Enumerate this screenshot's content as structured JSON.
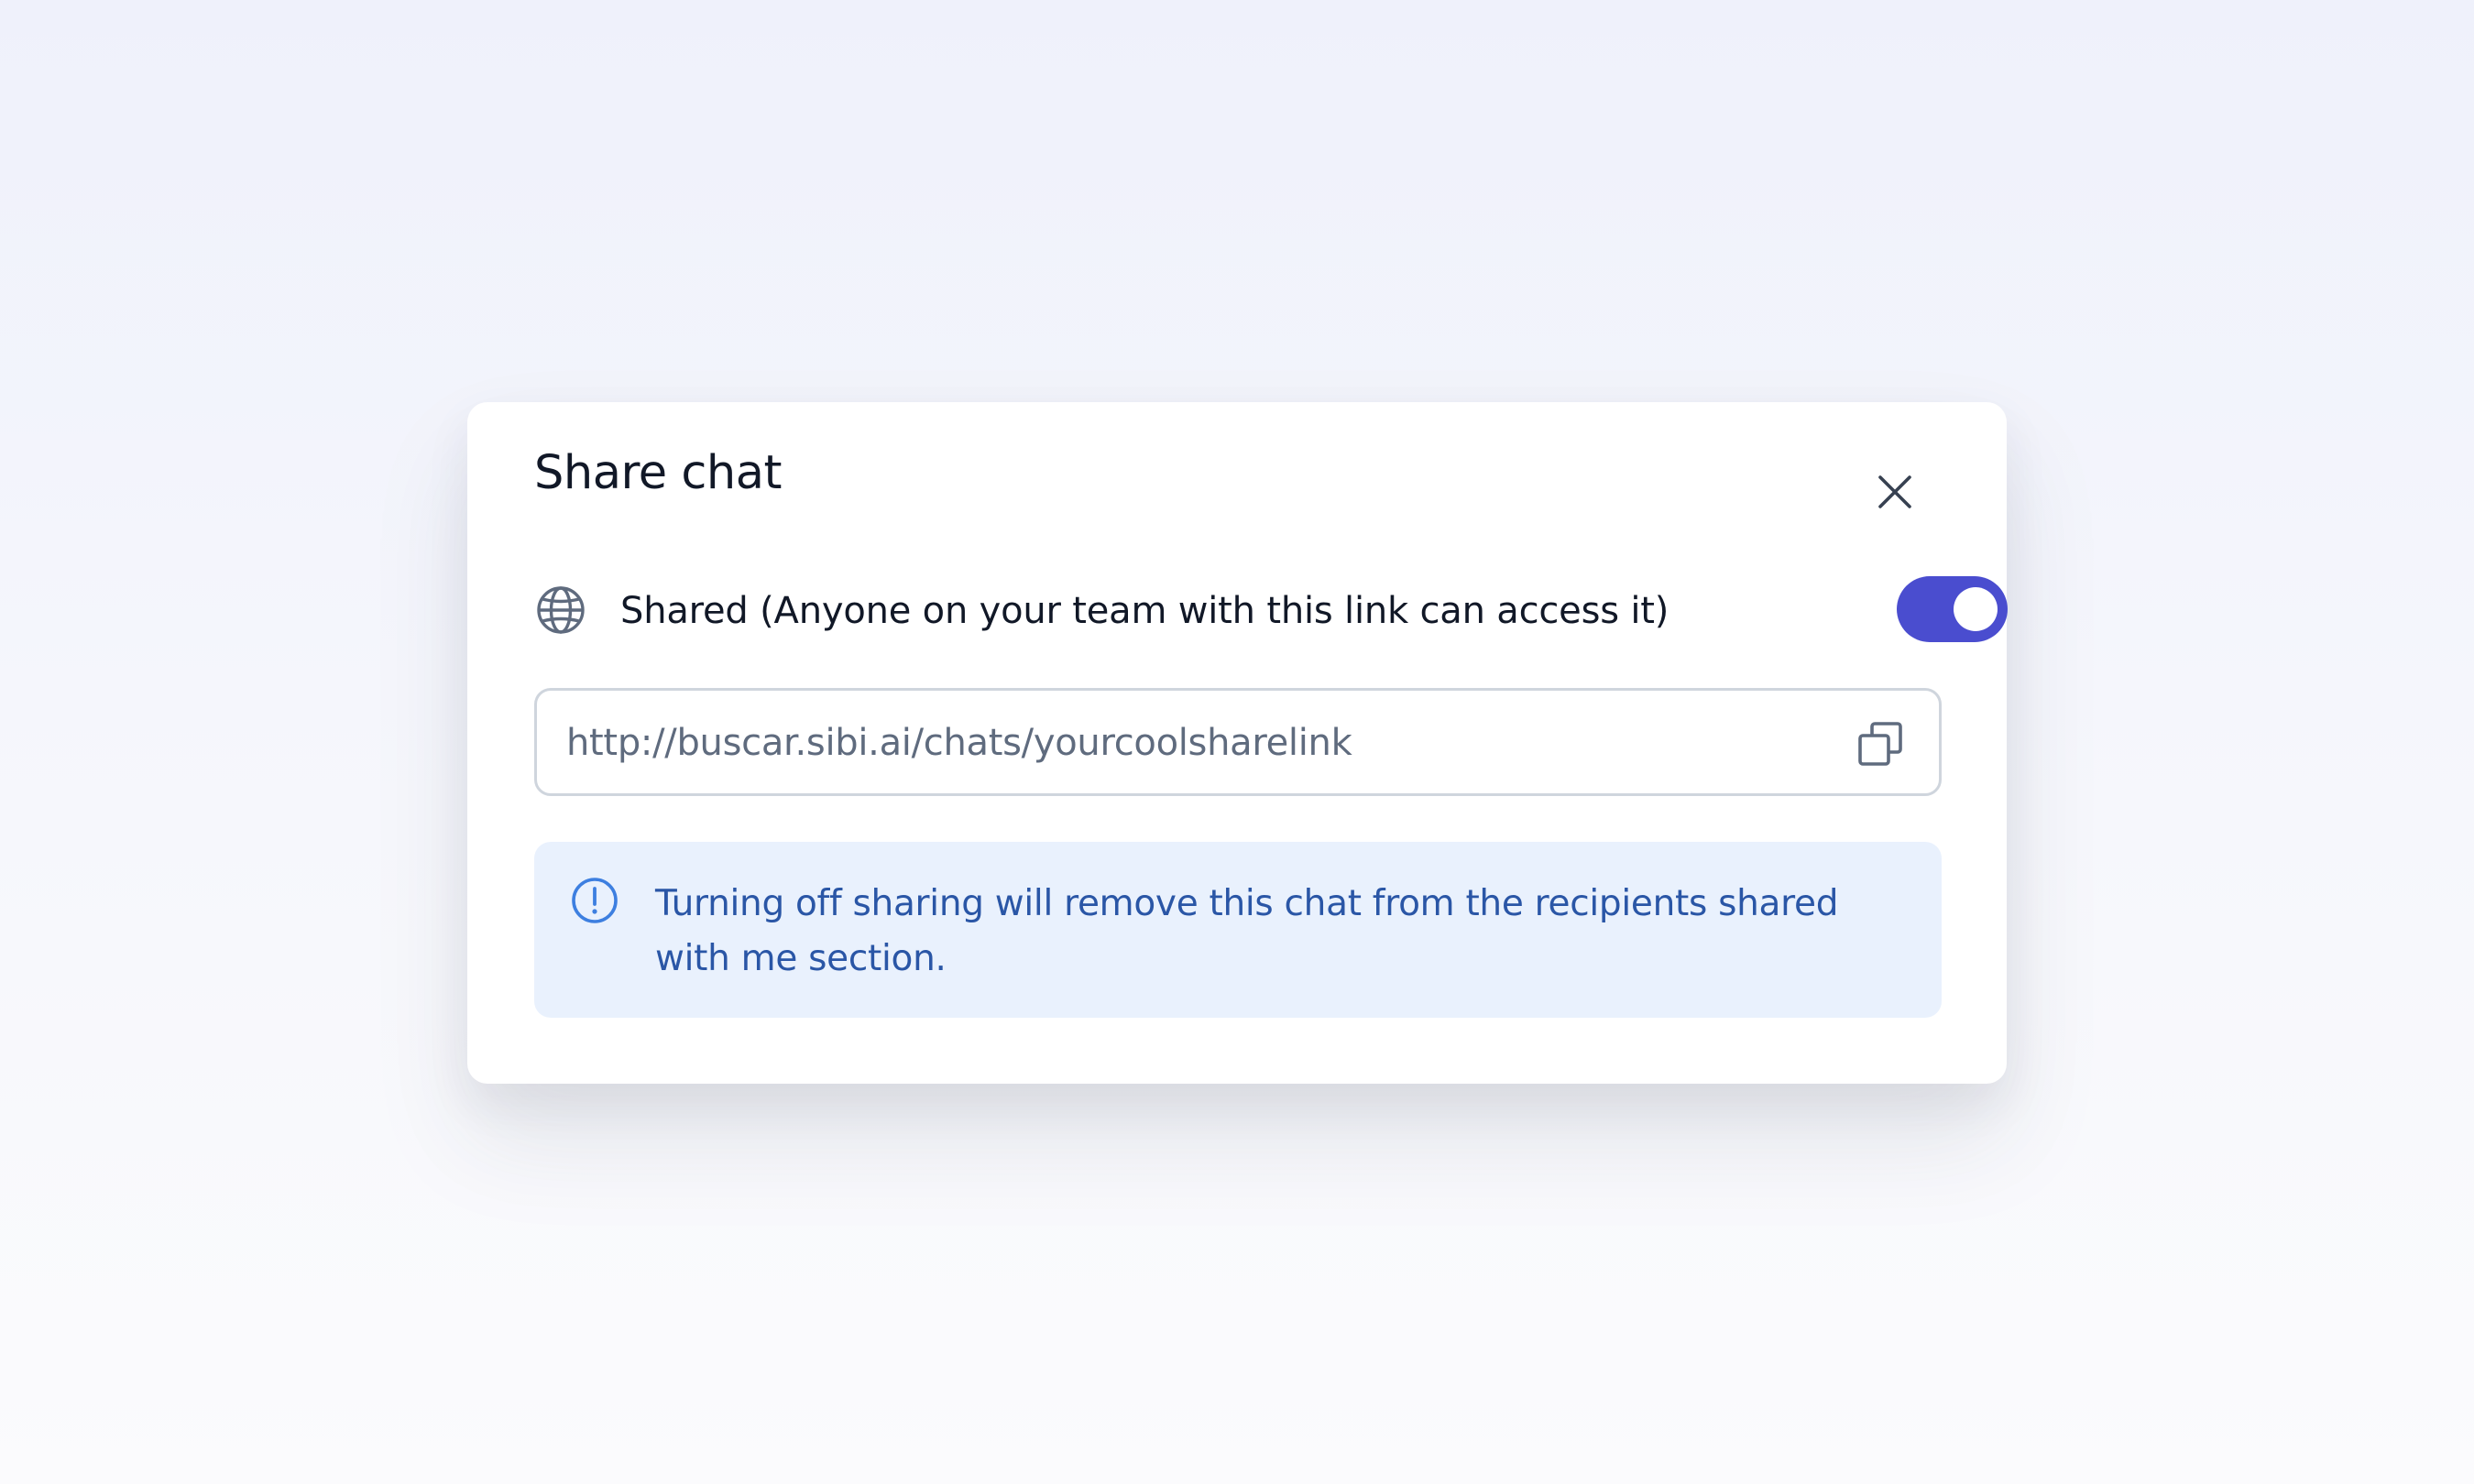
{
  "dialog": {
    "title": "Share chat",
    "close_icon": "close-icon"
  },
  "sharing": {
    "icon": "globe-icon",
    "label": "Shared (Anyone on your team with this link can access it)",
    "enabled": true,
    "toggle_color": "#4a4dcf"
  },
  "share_link": {
    "value": "http://buscar.sibi.ai/chats/yourcoolsharelink",
    "copy_icon": "copy-icon"
  },
  "info": {
    "icon": "alert-circle-icon",
    "text": "Turning off sharing will remove this chat from the recipients shared with me section.",
    "background": "#e9f1fd",
    "text_color": "#2a56a6"
  }
}
